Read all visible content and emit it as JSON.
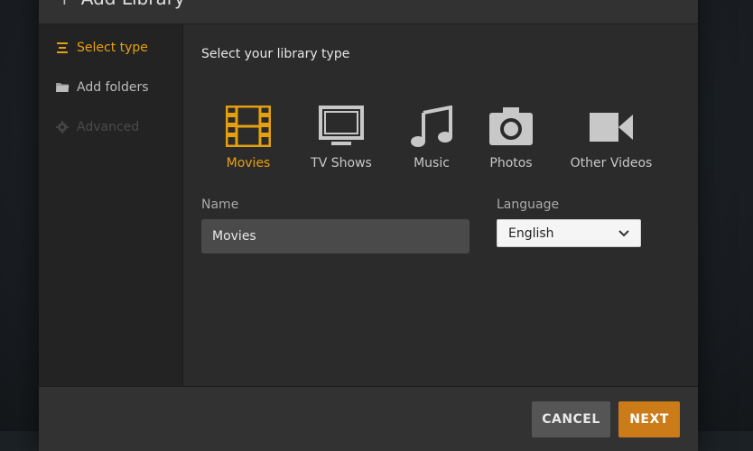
{
  "dialog": {
    "title": "Add Library"
  },
  "sidebar": {
    "items": [
      {
        "label": "Select type",
        "icon": "list-icon",
        "state": "active"
      },
      {
        "label": "Add folders",
        "icon": "folder-icon",
        "state": "normal"
      },
      {
        "label": "Advanced",
        "icon": "gear-icon",
        "state": "disabled"
      }
    ]
  },
  "main": {
    "section_title": "Select your library type",
    "types": [
      {
        "label": "Movies",
        "icon": "film-icon",
        "selected": true
      },
      {
        "label": "TV Shows",
        "icon": "tv-icon",
        "selected": false
      },
      {
        "label": "Music",
        "icon": "music-note-icon",
        "selected": false
      },
      {
        "label": "Photos",
        "icon": "camera-icon",
        "selected": false
      },
      {
        "label": "Other Videos",
        "icon": "video-camera-icon",
        "selected": false
      }
    ],
    "name_label": "Name",
    "name_value": "Movies",
    "language_label": "Language",
    "language_value": "English"
  },
  "footer": {
    "cancel_label": "CANCEL",
    "next_label": "NEXT"
  },
  "colors": {
    "accent": "#e5a00d",
    "next_button": "#cc7b19",
    "cancel_button": "#555555"
  }
}
